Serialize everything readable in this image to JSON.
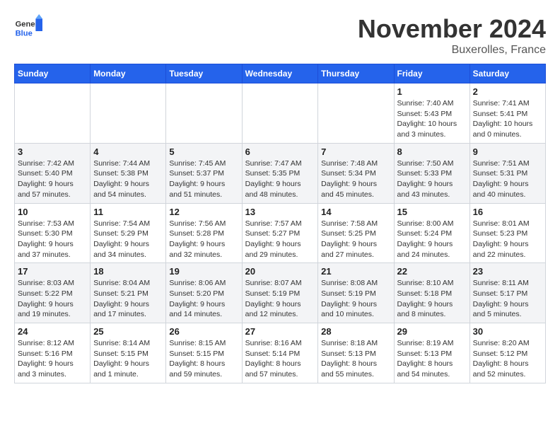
{
  "header": {
    "logo_general": "General",
    "logo_blue": "Blue",
    "month_title": "November 2024",
    "location": "Buxerolles, France"
  },
  "days_of_week": [
    "Sunday",
    "Monday",
    "Tuesday",
    "Wednesday",
    "Thursday",
    "Friday",
    "Saturday"
  ],
  "weeks": [
    [
      {
        "day": "",
        "info": ""
      },
      {
        "day": "",
        "info": ""
      },
      {
        "day": "",
        "info": ""
      },
      {
        "day": "",
        "info": ""
      },
      {
        "day": "",
        "info": ""
      },
      {
        "day": "1",
        "info": "Sunrise: 7:40 AM\nSunset: 5:43 PM\nDaylight: 10 hours and 3 minutes."
      },
      {
        "day": "2",
        "info": "Sunrise: 7:41 AM\nSunset: 5:41 PM\nDaylight: 10 hours and 0 minutes."
      }
    ],
    [
      {
        "day": "3",
        "info": "Sunrise: 7:42 AM\nSunset: 5:40 PM\nDaylight: 9 hours and 57 minutes."
      },
      {
        "day": "4",
        "info": "Sunrise: 7:44 AM\nSunset: 5:38 PM\nDaylight: 9 hours and 54 minutes."
      },
      {
        "day": "5",
        "info": "Sunrise: 7:45 AM\nSunset: 5:37 PM\nDaylight: 9 hours and 51 minutes."
      },
      {
        "day": "6",
        "info": "Sunrise: 7:47 AM\nSunset: 5:35 PM\nDaylight: 9 hours and 48 minutes."
      },
      {
        "day": "7",
        "info": "Sunrise: 7:48 AM\nSunset: 5:34 PM\nDaylight: 9 hours and 45 minutes."
      },
      {
        "day": "8",
        "info": "Sunrise: 7:50 AM\nSunset: 5:33 PM\nDaylight: 9 hours and 43 minutes."
      },
      {
        "day": "9",
        "info": "Sunrise: 7:51 AM\nSunset: 5:31 PM\nDaylight: 9 hours and 40 minutes."
      }
    ],
    [
      {
        "day": "10",
        "info": "Sunrise: 7:53 AM\nSunset: 5:30 PM\nDaylight: 9 hours and 37 minutes."
      },
      {
        "day": "11",
        "info": "Sunrise: 7:54 AM\nSunset: 5:29 PM\nDaylight: 9 hours and 34 minutes."
      },
      {
        "day": "12",
        "info": "Sunrise: 7:56 AM\nSunset: 5:28 PM\nDaylight: 9 hours and 32 minutes."
      },
      {
        "day": "13",
        "info": "Sunrise: 7:57 AM\nSunset: 5:27 PM\nDaylight: 9 hours and 29 minutes."
      },
      {
        "day": "14",
        "info": "Sunrise: 7:58 AM\nSunset: 5:25 PM\nDaylight: 9 hours and 27 minutes."
      },
      {
        "day": "15",
        "info": "Sunrise: 8:00 AM\nSunset: 5:24 PM\nDaylight: 9 hours and 24 minutes."
      },
      {
        "day": "16",
        "info": "Sunrise: 8:01 AM\nSunset: 5:23 PM\nDaylight: 9 hours and 22 minutes."
      }
    ],
    [
      {
        "day": "17",
        "info": "Sunrise: 8:03 AM\nSunset: 5:22 PM\nDaylight: 9 hours and 19 minutes."
      },
      {
        "day": "18",
        "info": "Sunrise: 8:04 AM\nSunset: 5:21 PM\nDaylight: 9 hours and 17 minutes."
      },
      {
        "day": "19",
        "info": "Sunrise: 8:06 AM\nSunset: 5:20 PM\nDaylight: 9 hours and 14 minutes."
      },
      {
        "day": "20",
        "info": "Sunrise: 8:07 AM\nSunset: 5:19 PM\nDaylight: 9 hours and 12 minutes."
      },
      {
        "day": "21",
        "info": "Sunrise: 8:08 AM\nSunset: 5:19 PM\nDaylight: 9 hours and 10 minutes."
      },
      {
        "day": "22",
        "info": "Sunrise: 8:10 AM\nSunset: 5:18 PM\nDaylight: 9 hours and 8 minutes."
      },
      {
        "day": "23",
        "info": "Sunrise: 8:11 AM\nSunset: 5:17 PM\nDaylight: 9 hours and 5 minutes."
      }
    ],
    [
      {
        "day": "24",
        "info": "Sunrise: 8:12 AM\nSunset: 5:16 PM\nDaylight: 9 hours and 3 minutes."
      },
      {
        "day": "25",
        "info": "Sunrise: 8:14 AM\nSunset: 5:15 PM\nDaylight: 9 hours and 1 minute."
      },
      {
        "day": "26",
        "info": "Sunrise: 8:15 AM\nSunset: 5:15 PM\nDaylight: 8 hours and 59 minutes."
      },
      {
        "day": "27",
        "info": "Sunrise: 8:16 AM\nSunset: 5:14 PM\nDaylight: 8 hours and 57 minutes."
      },
      {
        "day": "28",
        "info": "Sunrise: 8:18 AM\nSunset: 5:13 PM\nDaylight: 8 hours and 55 minutes."
      },
      {
        "day": "29",
        "info": "Sunrise: 8:19 AM\nSunset: 5:13 PM\nDaylight: 8 hours and 54 minutes."
      },
      {
        "day": "30",
        "info": "Sunrise: 8:20 AM\nSunset: 5:12 PM\nDaylight: 8 hours and 52 minutes."
      }
    ]
  ]
}
